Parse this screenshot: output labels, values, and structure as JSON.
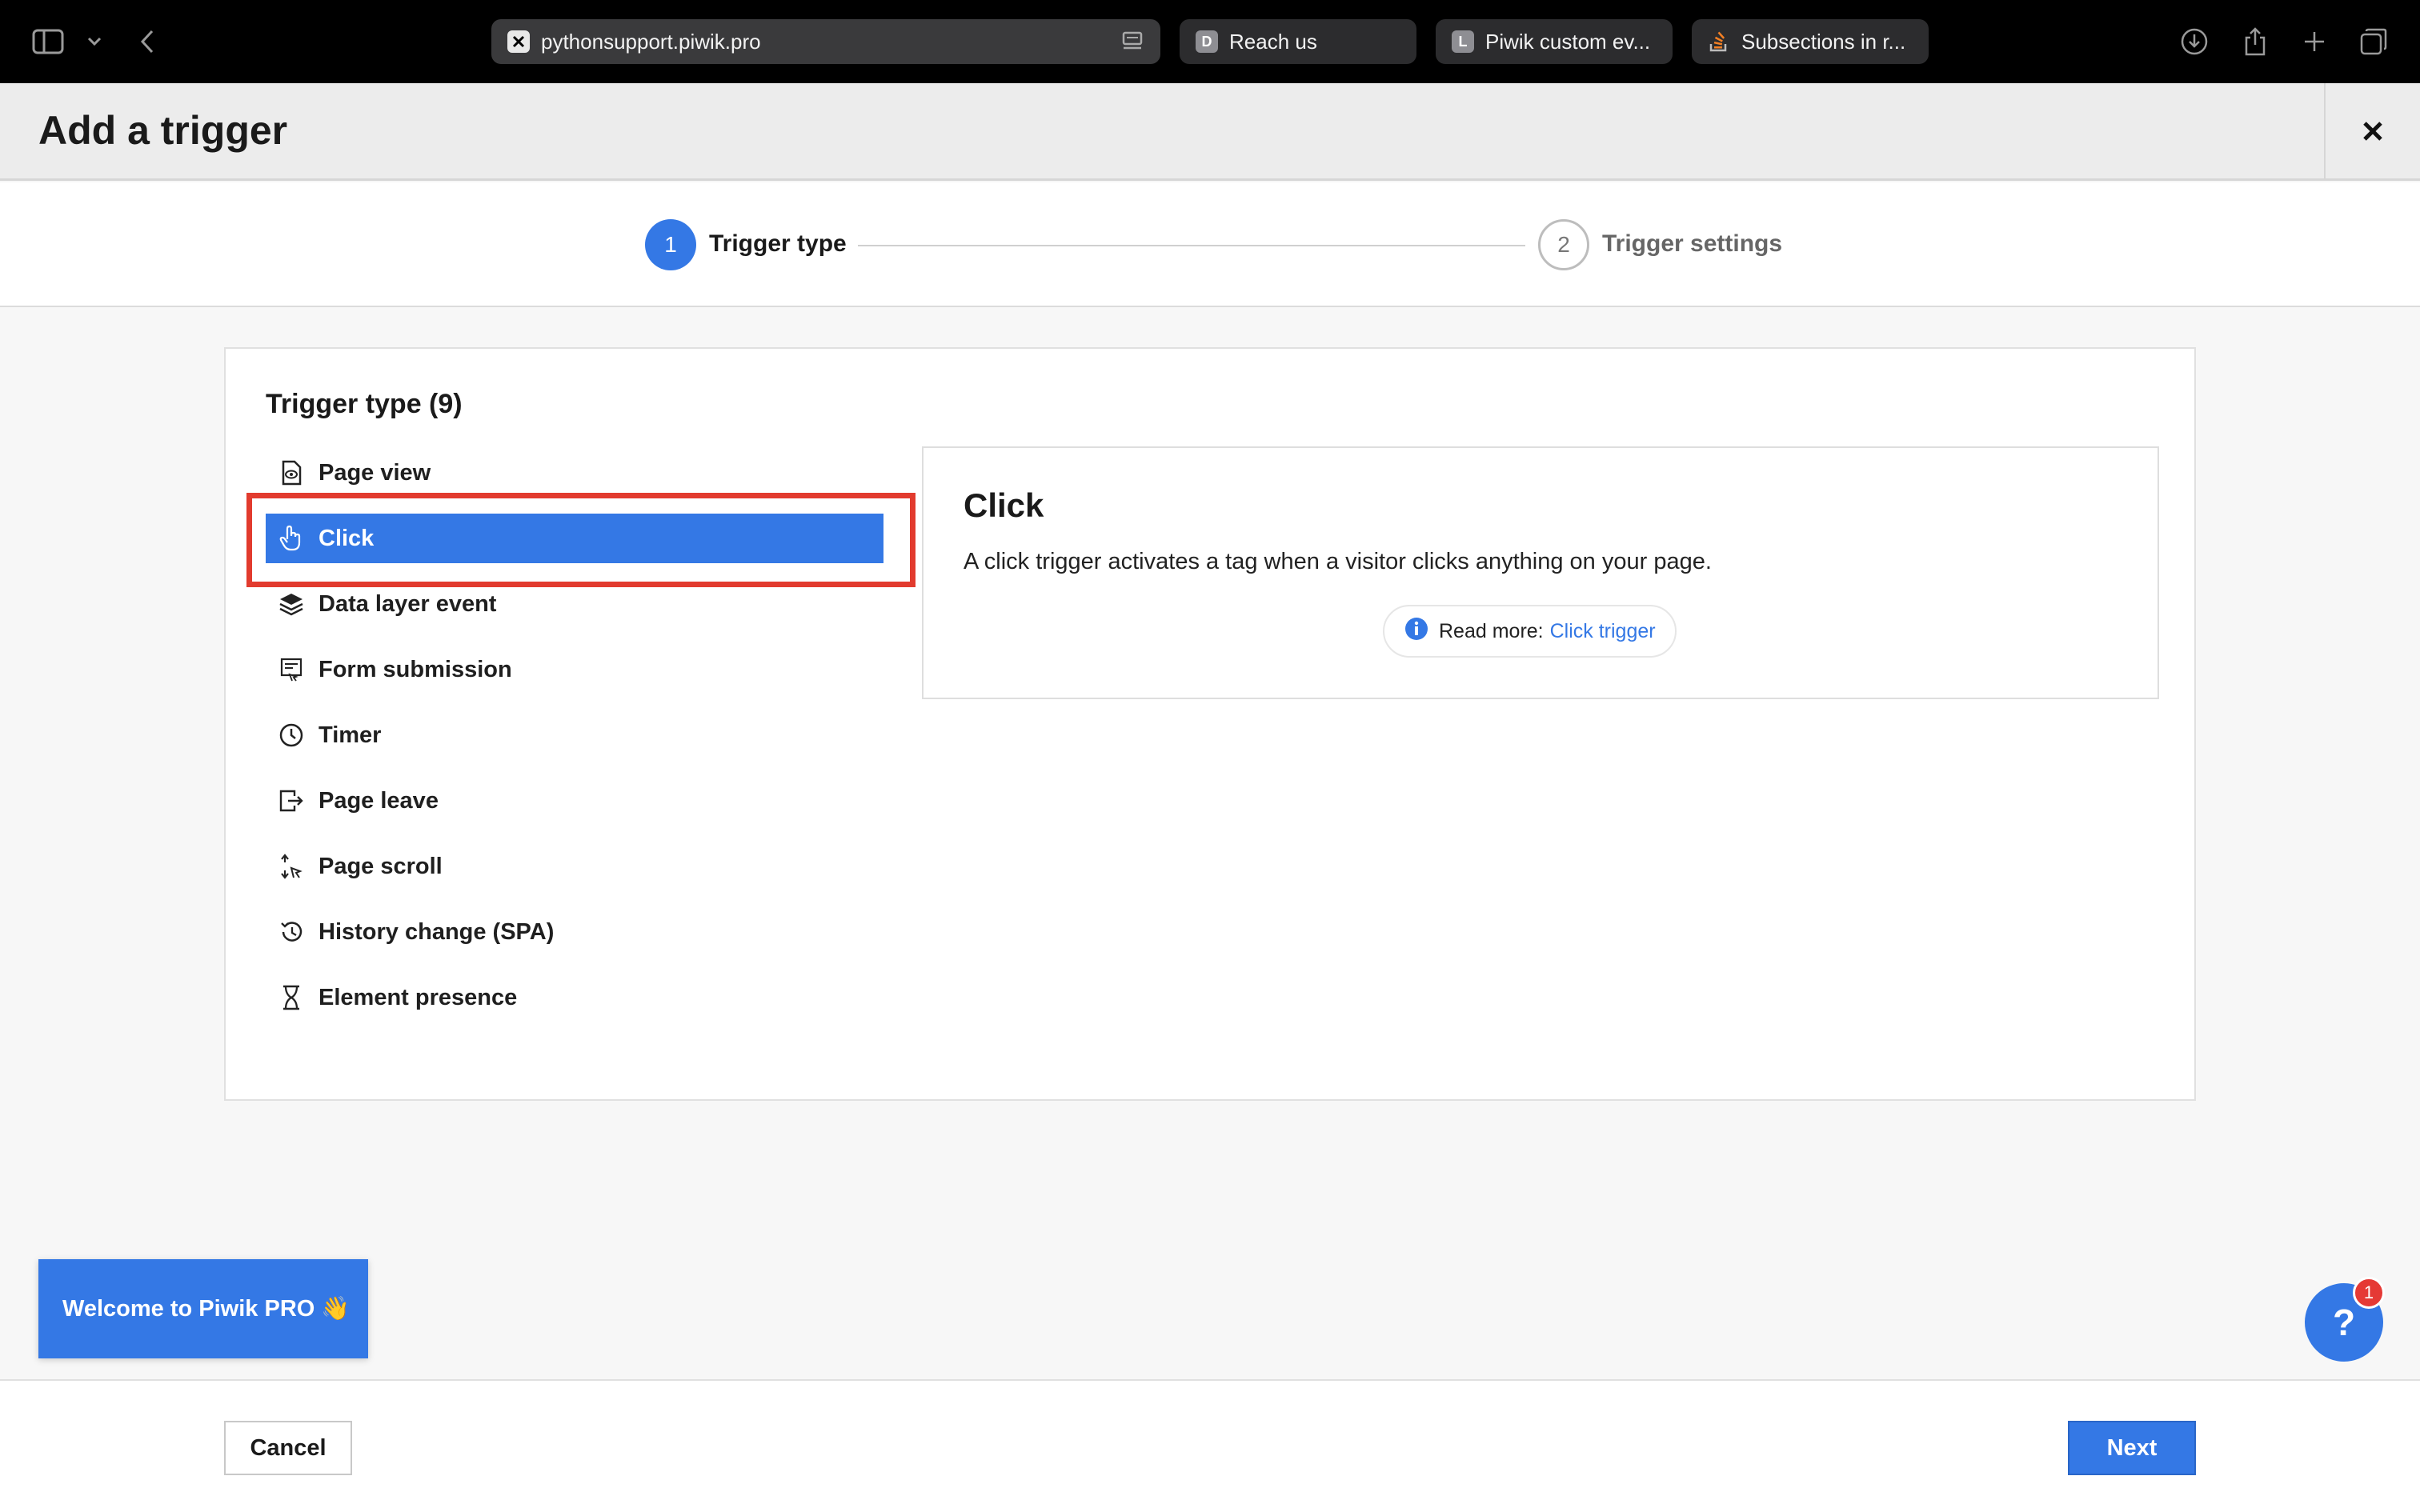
{
  "browser": {
    "url": "pythonsupport.piwik.pro",
    "tabs": [
      {
        "favicon": "D",
        "title": "Reach us"
      },
      {
        "favicon": "L",
        "title": "Piwik custom ev..."
      },
      {
        "favicon": "",
        "title": "Subsections in r..."
      }
    ]
  },
  "header": {
    "title": "Add a trigger"
  },
  "stepper": {
    "steps": [
      {
        "number": "1",
        "label": "Trigger type"
      },
      {
        "number": "2",
        "label": "Trigger settings"
      }
    ]
  },
  "card": {
    "title": "Trigger type (9)",
    "items": [
      {
        "label": "Page view",
        "icon": "page-view-icon"
      },
      {
        "label": "Click",
        "icon": "hand-pointer-icon"
      },
      {
        "label": "Data layer event",
        "icon": "layers-icon"
      },
      {
        "label": "Form submission",
        "icon": "form-icon"
      },
      {
        "label": "Timer",
        "icon": "clock-icon"
      },
      {
        "label": "Page leave",
        "icon": "exit-icon"
      },
      {
        "label": "Page scroll",
        "icon": "scroll-icon"
      },
      {
        "label": "History change (SPA)",
        "icon": "history-icon"
      },
      {
        "label": "Element presence",
        "icon": "hourglass-icon"
      }
    ],
    "detail": {
      "title": "Click",
      "description": "A click trigger activates a tag when a visitor clicks anything on your page.",
      "read_more_label": "Read more:",
      "read_more_link": "Click trigger"
    }
  },
  "welcome": {
    "label": "Welcome to Piwik PRO 👋"
  },
  "help": {
    "label": "?",
    "badge": "1"
  },
  "footer": {
    "cancel": "Cancel",
    "next": "Next"
  },
  "colors": {
    "accent": "#3478e5",
    "highlight": "#e23b2e"
  }
}
